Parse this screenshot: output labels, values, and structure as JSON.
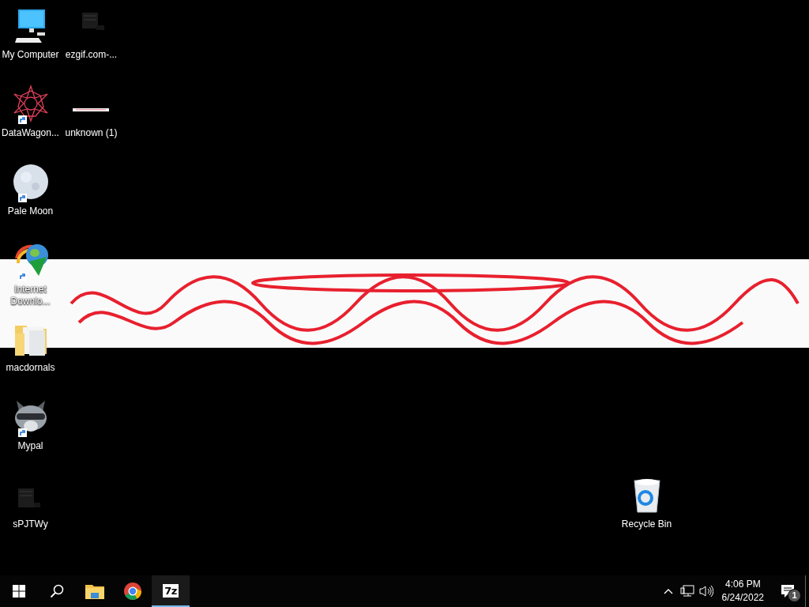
{
  "desktop": {
    "columns": [
      [
        {
          "label": "My Computer",
          "shortcut": false
        },
        {
          "label": "DataWagon...",
          "shortcut": true
        },
        {
          "label": "Pale Moon",
          "shortcut": true
        },
        {
          "label": "Internet Downlo...",
          "shortcut": true
        },
        {
          "label": "macdornals",
          "shortcut": false
        },
        {
          "label": "Mypal",
          "shortcut": true
        },
        {
          "label": "sPJTWy",
          "shortcut": false
        }
      ],
      [
        {
          "label": "ezgif.com-...",
          "shortcut": false
        },
        {
          "label": "unknown (1)",
          "shortcut": false
        }
      ]
    ]
  },
  "recycle_bin": {
    "label": "Recycle Bin"
  },
  "taskbar": {
    "apps": [
      {
        "kind": "start",
        "running": false
      },
      {
        "kind": "search",
        "running": false
      },
      {
        "kind": "explorer",
        "running": false
      },
      {
        "kind": "chrome",
        "running": false
      },
      {
        "kind": "archiver",
        "label": "7z",
        "running": true
      }
    ],
    "time": "4:06 PM",
    "date": "6/24/2022",
    "notification_count": "1"
  }
}
